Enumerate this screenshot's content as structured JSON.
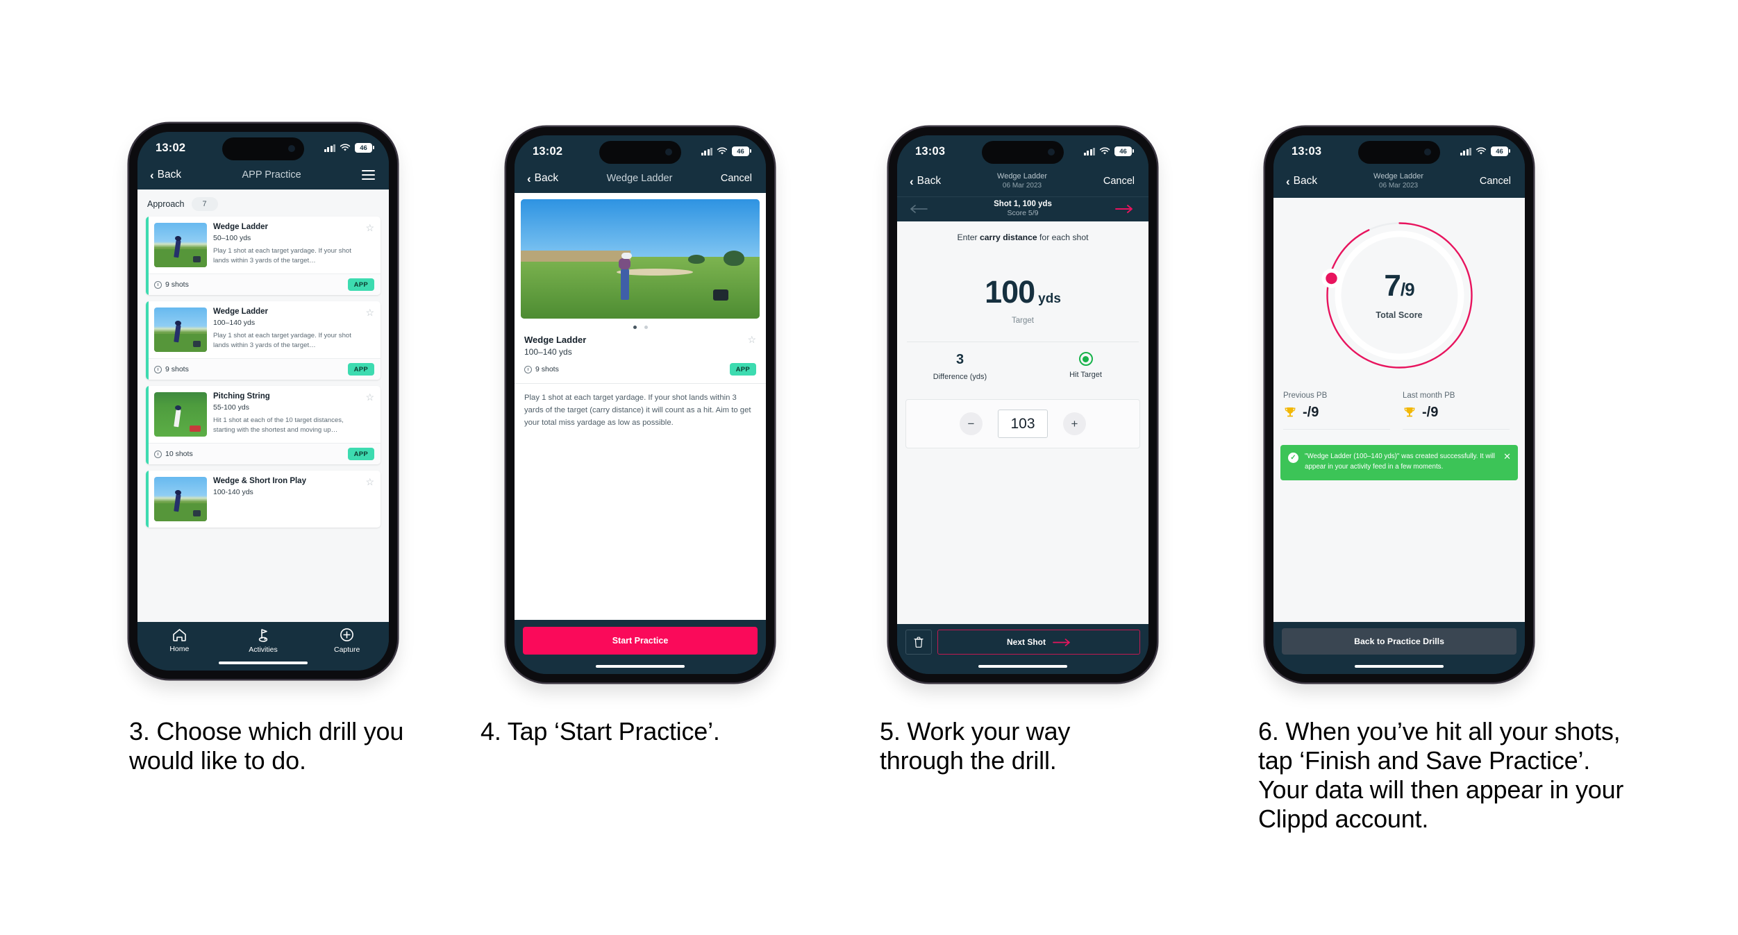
{
  "steps": [
    {
      "caption": "3. Choose which drill you would like to do.",
      "status": {
        "time": "13:02",
        "battery": "46"
      },
      "nav": {
        "back": "Back",
        "title": "APP Practice"
      },
      "category": {
        "label": "Approach",
        "count": "7"
      },
      "cards": [
        {
          "title": "Wedge Ladder",
          "range": "50–100 yds",
          "desc": "Play 1 shot at each target yardage. If your shot lands within 3 yards of the target…",
          "shots": "9 shots",
          "tag": "APP"
        },
        {
          "title": "Wedge Ladder",
          "range": "100–140 yds",
          "desc": "Play 1 shot at each target yardage. If your shot lands within 3 yards of the target…",
          "shots": "9 shots",
          "tag": "APP"
        },
        {
          "title": "Pitching String",
          "range": "55-100 yds",
          "desc": "Hit 1 shot at each of the 10 target distances, starting with the shortest and moving up…",
          "shots": "10 shots",
          "tag": "APP"
        },
        {
          "title": "Wedge & Short Iron Play",
          "range": "100-140 yds",
          "desc": "",
          "shots": "",
          "tag": ""
        }
      ],
      "tabs": [
        {
          "label": "Home",
          "icon": "home-icon"
        },
        {
          "label": "Activities",
          "icon": "golf-flag-icon"
        },
        {
          "label": "Capture",
          "icon": "plus-circle-icon"
        }
      ]
    },
    {
      "caption": "4. Tap ‘Start Practice’.",
      "status": {
        "time": "13:02",
        "battery": "46"
      },
      "nav": {
        "back": "Back",
        "title": "Wedge Ladder",
        "cancel": "Cancel"
      },
      "detail": {
        "title": "Wedge Ladder",
        "range": "100–140 yds",
        "shots": "9 shots",
        "tag": "APP",
        "description": "Play 1 shot at each target yardage. If your shot lands within 3 yards of the target (carry distance) it will count as a hit. Aim to get your total miss yardage as low as possible.",
        "cta": "Start Practice"
      }
    },
    {
      "caption": "5. Work your way through the drill.",
      "status": {
        "time": "13:03",
        "battery": "46"
      },
      "nav": {
        "back": "Back",
        "title": "Wedge Ladder",
        "subtitle": "06 Mar 2023",
        "cancel": "Cancel"
      },
      "shotbar": {
        "title": "Shot 1, 100 yds",
        "score": "Score 5/9"
      },
      "entry": {
        "prompt_pre": "Enter ",
        "prompt_bold": "carry distance",
        "prompt_post": " for each shot",
        "target_value": "100",
        "target_unit": "yds",
        "target_label": "Target",
        "difference_value": "3",
        "difference_label": "Difference (yds)",
        "hit_label": "Hit Target",
        "stepper_value": "103",
        "minus": "−",
        "plus": "+",
        "next": "Next Shot"
      }
    },
    {
      "caption": "6. When you’ve hit all your shots, tap ‘Finish and Save Practice’. Your data will then appear in your Clippd account.",
      "status": {
        "time": "13:03",
        "battery": "46"
      },
      "nav": {
        "back": "Back",
        "title": "Wedge Ladder",
        "subtitle": "06 Mar 2023",
        "cancel": "Cancel"
      },
      "results": {
        "score_num": "7",
        "score_den": "9",
        "score_label": "Total Score",
        "previous_pb_label": "Previous PB",
        "previous_pb_value": "-/9",
        "last_month_pb_label": "Last month PB",
        "last_month_pb_value": "-/9",
        "toast": "\"Wedge Ladder (100–140 yds)\" was created successfully. It will appear in your activity feed in a few moments.",
        "button": "Back to Practice Drills"
      }
    }
  ],
  "colors": {
    "nav_bg": "#16303f",
    "accent_pink": "#fa0a5a",
    "accent_teal": "#3ddbb0",
    "toast_green": "#3cc457",
    "hit_green": "#17b24a"
  }
}
